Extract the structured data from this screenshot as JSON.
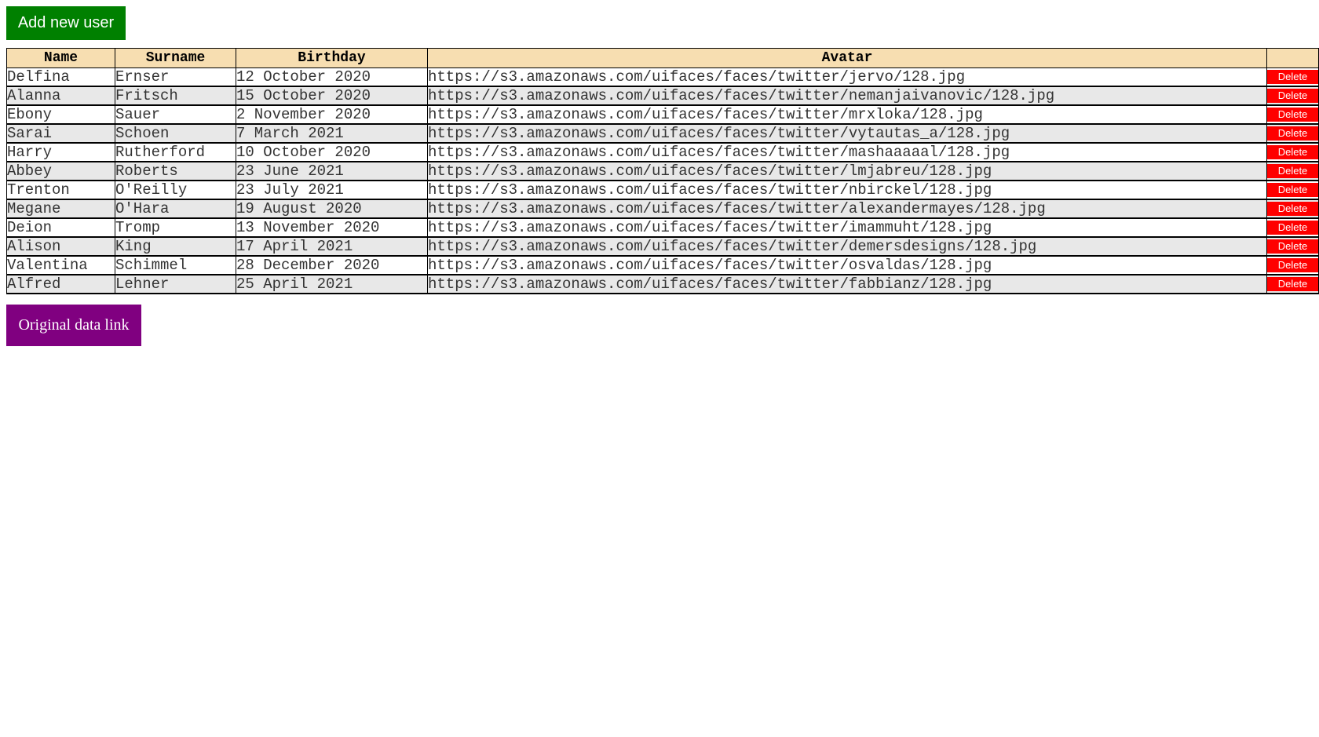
{
  "toolbar": {
    "add_user_label": "Add new user"
  },
  "table": {
    "headers": [
      "Name",
      "Surname",
      "Birthday",
      "Avatar",
      ""
    ],
    "delete_label": "Delete",
    "rows": [
      {
        "name": "Delfina",
        "surname": "Ernser",
        "birthday": "12 October 2020",
        "avatar": "https://s3.amazonaws.com/uifaces/faces/twitter/jervo/128.jpg"
      },
      {
        "name": "Alanna",
        "surname": "Fritsch",
        "birthday": "15 October 2020",
        "avatar": "https://s3.amazonaws.com/uifaces/faces/twitter/nemanjaivanovic/128.jpg"
      },
      {
        "name": "Ebony",
        "surname": "Sauer",
        "birthday": "2 November 2020",
        "avatar": "https://s3.amazonaws.com/uifaces/faces/twitter/mrxloka/128.jpg"
      },
      {
        "name": "Sarai",
        "surname": "Schoen",
        "birthday": "7 March 2021",
        "avatar": "https://s3.amazonaws.com/uifaces/faces/twitter/vytautas_a/128.jpg"
      },
      {
        "name": "Harry",
        "surname": "Rutherford",
        "birthday": "10 October 2020",
        "avatar": "https://s3.amazonaws.com/uifaces/faces/twitter/mashaaaaal/128.jpg"
      },
      {
        "name": "Abbey",
        "surname": "Roberts",
        "birthday": "23 June 2021",
        "avatar": "https://s3.amazonaws.com/uifaces/faces/twitter/lmjabreu/128.jpg"
      },
      {
        "name": "Trenton",
        "surname": "O'Reilly",
        "birthday": "23 July 2021",
        "avatar": "https://s3.amazonaws.com/uifaces/faces/twitter/nbirckel/128.jpg"
      },
      {
        "name": "Megane",
        "surname": "O'Hara",
        "birthday": "19 August 2020",
        "avatar": "https://s3.amazonaws.com/uifaces/faces/twitter/alexandermayes/128.jpg"
      },
      {
        "name": "Deion",
        "surname": "Tromp",
        "birthday": "13 November 2020",
        "avatar": "https://s3.amazonaws.com/uifaces/faces/twitter/imammuht/128.jpg"
      },
      {
        "name": "Alison",
        "surname": "King",
        "birthday": "17 April 2021",
        "avatar": "https://s3.amazonaws.com/uifaces/faces/twitter/demersdesigns/128.jpg"
      },
      {
        "name": "Valentina",
        "surname": "Schimmel",
        "birthday": "28 December 2020",
        "avatar": "https://s3.amazonaws.com/uifaces/faces/twitter/osvaldas/128.jpg"
      },
      {
        "name": "Alfred",
        "surname": "Lehner",
        "birthday": "25 April 2021",
        "avatar": "https://s3.amazonaws.com/uifaces/faces/twitter/fabbianz/128.jpg"
      }
    ]
  },
  "footer": {
    "original_link_label": "Original data link"
  },
  "colors": {
    "add_button": "#008000",
    "header_bg": "#f7deb1",
    "delete_button": "#ff0000",
    "link_button": "#800080",
    "row_alt": "#e8e8e8"
  }
}
